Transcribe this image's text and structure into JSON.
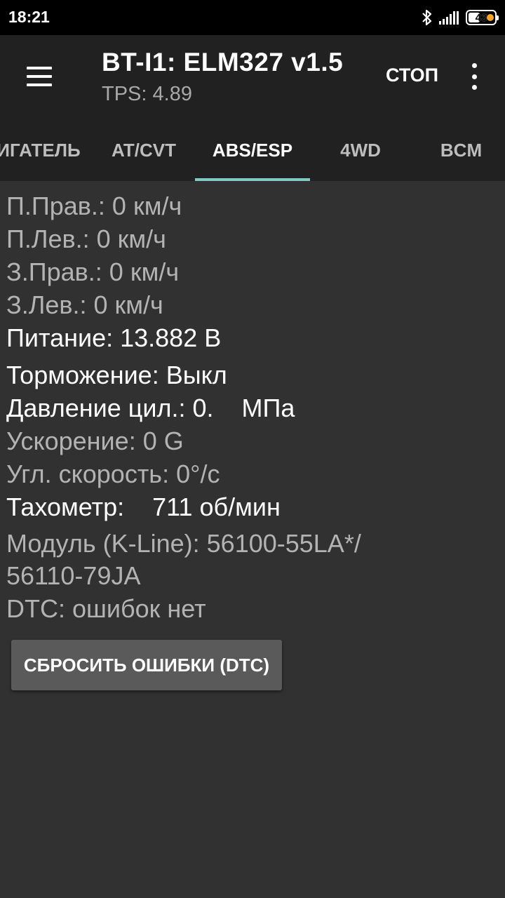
{
  "status_bar": {
    "time": "18:21",
    "battery_level": "43"
  },
  "app_bar": {
    "title": "BT-I1: ELM327 v1.5",
    "subtitle": "TPS: 4.89",
    "stop_label": "СТОП"
  },
  "tabs": [
    {
      "label": "ИГАТЕЛЬ",
      "active": false
    },
    {
      "label": "AT/CVT",
      "active": false
    },
    {
      "label": "ABS/ESP",
      "active": true
    },
    {
      "label": "4WD",
      "active": false
    },
    {
      "label": "BCM",
      "active": false
    }
  ],
  "readings": {
    "front_right": "П.Прав.: 0 км/ч",
    "front_left": "П.Лев.: 0 км/ч",
    "rear_right": "З.Прав.: 0 км/ч",
    "rear_left": "З.Лев.: 0 км/ч",
    "power": "Питание: 13.882 В",
    "braking": "Торможение: Выкл",
    "cylinder_pressure": "Давление цил.: 0.    МПа",
    "acceleration": "Ускорение: 0 G",
    "angular_speed": "Угл. скорость: 0°/с",
    "tachometer": "Тахометр:    711 об/мин",
    "module": "Модуль (K-Line): 56100-55LA*/ 56110-79JA",
    "dtc": "DTC: ошибок нет"
  },
  "reset_button_label": "СБРОСИТЬ ОШИБКИ (DTC)",
  "colors": {
    "background": "#313131",
    "toolbar": "#212121",
    "tab_indicator": "#80cbc4",
    "button": "#5a5a5a"
  }
}
